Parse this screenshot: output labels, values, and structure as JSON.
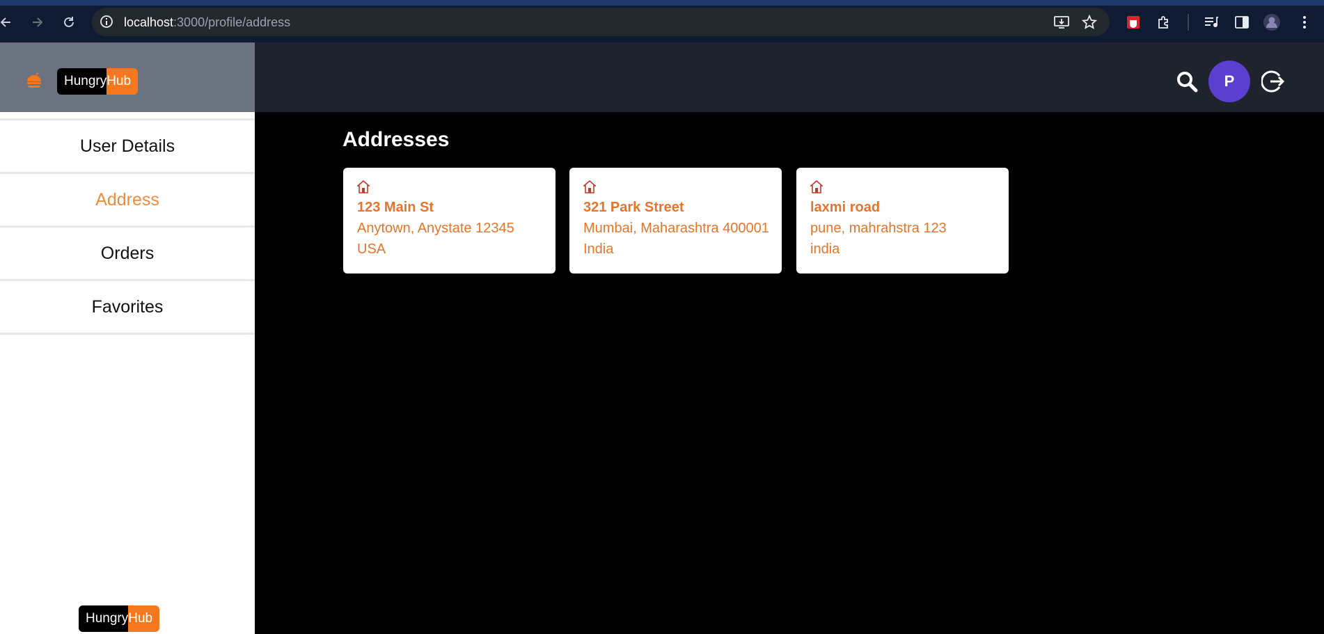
{
  "browser": {
    "url_host": "localhost",
    "url_path": ":3000/profile/address"
  },
  "brand": {
    "name_part1": "Hungry",
    "name_part2": "Hub",
    "accent_color": "#f5781e"
  },
  "header": {
    "avatar_initial": "P"
  },
  "sidebar": {
    "items": [
      {
        "label": "User Details"
      },
      {
        "label": "Address"
      },
      {
        "label": "Orders"
      },
      {
        "label": "Favorites"
      }
    ],
    "active": "Address"
  },
  "main": {
    "title": "Addresses",
    "addresses": [
      {
        "street": "123 Main St",
        "city_line": "Anytown, Anystate 12345",
        "country": "USA"
      },
      {
        "street": "321 Park Street",
        "city_line": "Mumbai, Maharashtra 400001",
        "country": "India"
      },
      {
        "street": "laxmi road",
        "city_line": "pune, mahrahstra 123",
        "country": "india"
      }
    ]
  },
  "footer": {
    "name_part1": "Hungry",
    "name_part2": "Hub"
  }
}
